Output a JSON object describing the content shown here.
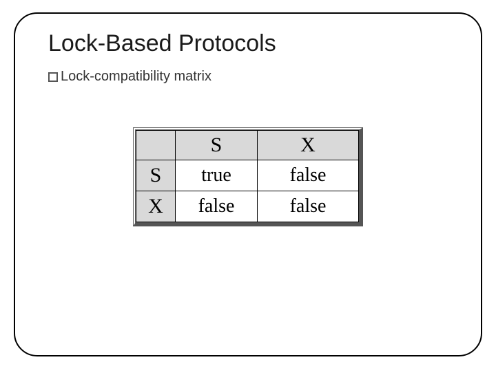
{
  "title": "Lock-Based Protocols",
  "subtitle": "Lock-compatibility matrix",
  "chart_data": {
    "type": "table",
    "title": "Lock-compatibility matrix",
    "col_headers": [
      "S",
      "X"
    ],
    "row_headers": [
      "S",
      "X"
    ],
    "rows": [
      {
        "header": "S",
        "values": [
          "true",
          "false"
        ]
      },
      {
        "header": "X",
        "values": [
          "false",
          "false"
        ]
      }
    ]
  }
}
